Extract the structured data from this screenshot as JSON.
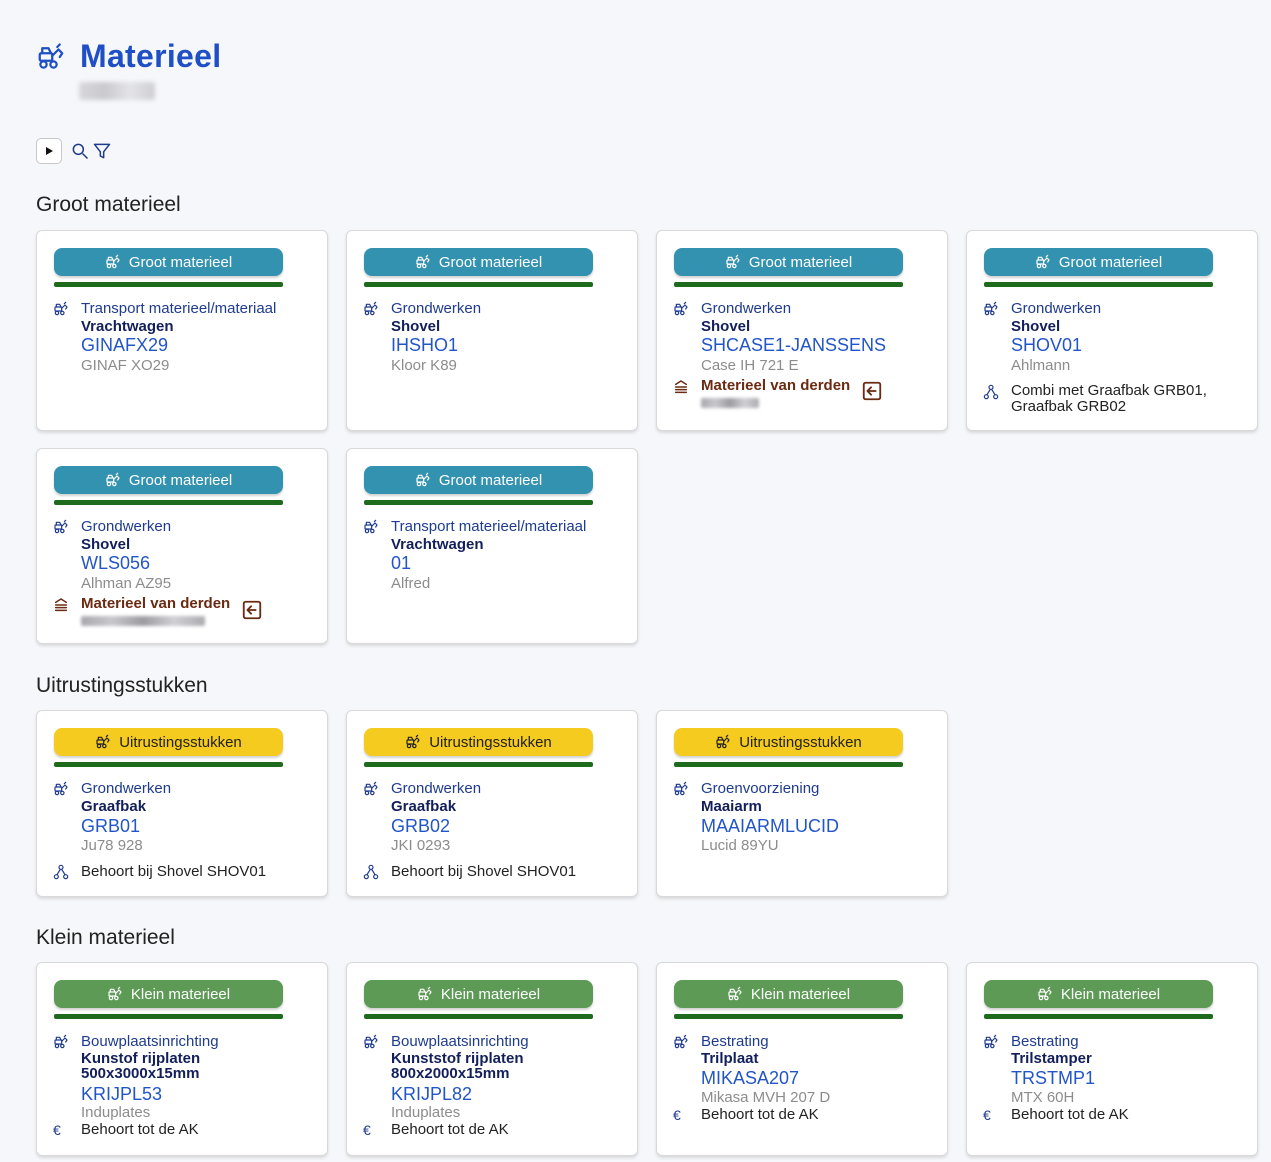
{
  "header": {
    "title": "Materieel"
  },
  "colors": {
    "accent": "#1f4fc4",
    "groot": "#3492b1",
    "uitrusting": "#f6cb1f",
    "klein": "#5c9a55",
    "bar": "#1e6b1e"
  },
  "sections": [
    {
      "title": "Groot materieel",
      "cards": [
        {
          "badge": "Groot materieel",
          "cat": "Transport materieel/materiaal",
          "sub": "Vrachtwagen",
          "code": "GINAFX29",
          "model": "GINAF XO29"
        },
        {
          "badge": "Groot materieel",
          "cat": "Grondwerken",
          "sub": "Shovel",
          "code": "IHSHO1",
          "model": "Kloor K89"
        },
        {
          "badge": "Groot materieel",
          "cat": "Grondwerken",
          "sub": "Shovel",
          "code": "SHCASE1-JANSSENS",
          "model": "Case IH 721 E",
          "extra": "Materieel van derden"
        },
        {
          "badge": "Groot materieel",
          "cat": "Grondwerken",
          "sub": "Shovel",
          "code": "SHOV01",
          "model": "Ahlmann",
          "note_line1": "Combi met Graafbak GRB01,",
          "note_line2": "Graafbak GRB02"
        },
        {
          "badge": "Groot materieel",
          "cat": "Grondwerken",
          "sub": "Shovel",
          "code": "WLS056",
          "model": "Alhman AZ95",
          "extra": "Materieel van derden"
        },
        {
          "badge": "Groot materieel",
          "cat": "Transport materieel/materiaal",
          "sub": "Vrachtwagen",
          "code": "01",
          "model": "Alfred"
        }
      ]
    },
    {
      "title": "Uitrustingsstukken",
      "cards": [
        {
          "badge": "Uitrustingsstukken",
          "cat": "Grondwerken",
          "sub": "Graafbak",
          "code": "GRB01",
          "model": "Ju78 928",
          "note": "Behoort bij Shovel SHOV01"
        },
        {
          "badge": "Uitrustingsstukken",
          "cat": "Grondwerken",
          "sub": "Graafbak",
          "code": "GRB02",
          "model": "JKI 0293",
          "note": "Behoort bij Shovel SHOV01"
        },
        {
          "badge": "Uitrustingsstukken",
          "cat": "Groenvoorziening",
          "sub": "Maaiarm",
          "code": "MAAIARMLUCID",
          "model": "Lucid 89YU"
        }
      ]
    },
    {
      "title": "Klein materieel",
      "cards": [
        {
          "badge": "Klein materieel",
          "cat": "Bouwplaatsinrichting",
          "sub1": "Kunstof rijplaten",
          "sub2": "500x3000x15mm",
          "code": "KRIJPL53",
          "model": "Induplates",
          "note": "Behoort tot de AK"
        },
        {
          "badge": "Klein materieel",
          "cat": "Bouwplaatsinrichting",
          "sub1": "Kunststof rijplaten",
          "sub2": "800x2000x15mm",
          "code": "KRIJPL82",
          "model": "Induplates",
          "note": "Behoort tot de AK"
        },
        {
          "badge": "Klein materieel",
          "cat": "Bestrating",
          "sub": "Trilplaat",
          "code": "MIKASA207",
          "model": "Mikasa MVH 207 D",
          "note": "Behoort tot de AK"
        },
        {
          "badge": "Klein materieel",
          "cat": "Bestrating",
          "sub": "Trilstamper",
          "code": "TRSTMP1",
          "model": "MTX 60H",
          "note": "Behoort tot de AK"
        }
      ]
    }
  ]
}
